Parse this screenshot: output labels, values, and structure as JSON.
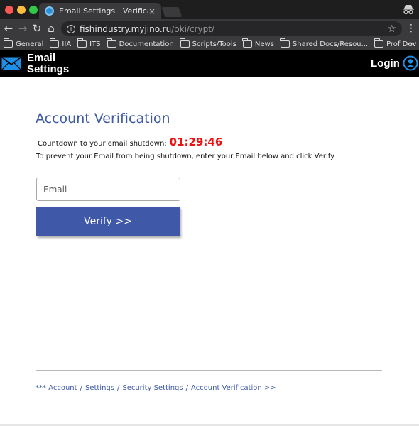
{
  "browser": {
    "tab_title": "Email Settings | Verification",
    "tab_close": "×",
    "url_host": "fishindustry.myjino.ru",
    "url_path": "/oki/crypt/",
    "nav": {
      "back": "←",
      "forward": "→",
      "reload": "↻",
      "home": "⌂",
      "star": "☆",
      "menu": "⋮"
    },
    "bookmarks": [
      {
        "label": "General",
        "icon": "folder-icon"
      },
      {
        "label": "IIA",
        "icon": "folder-icon"
      },
      {
        "label": "ITS",
        "icon": "folder-icon"
      },
      {
        "label": "Documentation",
        "icon": "folder-icon"
      },
      {
        "label": "Scripts/Tools",
        "icon": "folder-icon"
      },
      {
        "label": "News",
        "icon": "folder-icon"
      },
      {
        "label": "Shared Docs/Resou...",
        "icon": "folder-icon"
      },
      {
        "label": "Prof Dev",
        "icon": "folder-icon"
      }
    ],
    "bookmarks_more": "»"
  },
  "site": {
    "brand_line1": "Email",
    "brand_line2": "Settings",
    "login": "Login"
  },
  "main": {
    "title": "Account Verification",
    "countdown_label": "Countdown to your email shutdown:",
    "countdown_value": "01:29:46",
    "instructions": "To prevent your Email from being shutdown, enter your Email below and click Verify",
    "email_placeholder": "Email",
    "verify_label": "Verify >>"
  },
  "footer": {
    "prefix": "***",
    "items": [
      "Account",
      "Settings",
      "Security Settings",
      "Account Verification >>"
    ],
    "separator": "/"
  },
  "colors": {
    "accent": "#3e5aa6",
    "countdown": "#ee1111",
    "header_bg": "#000000"
  }
}
